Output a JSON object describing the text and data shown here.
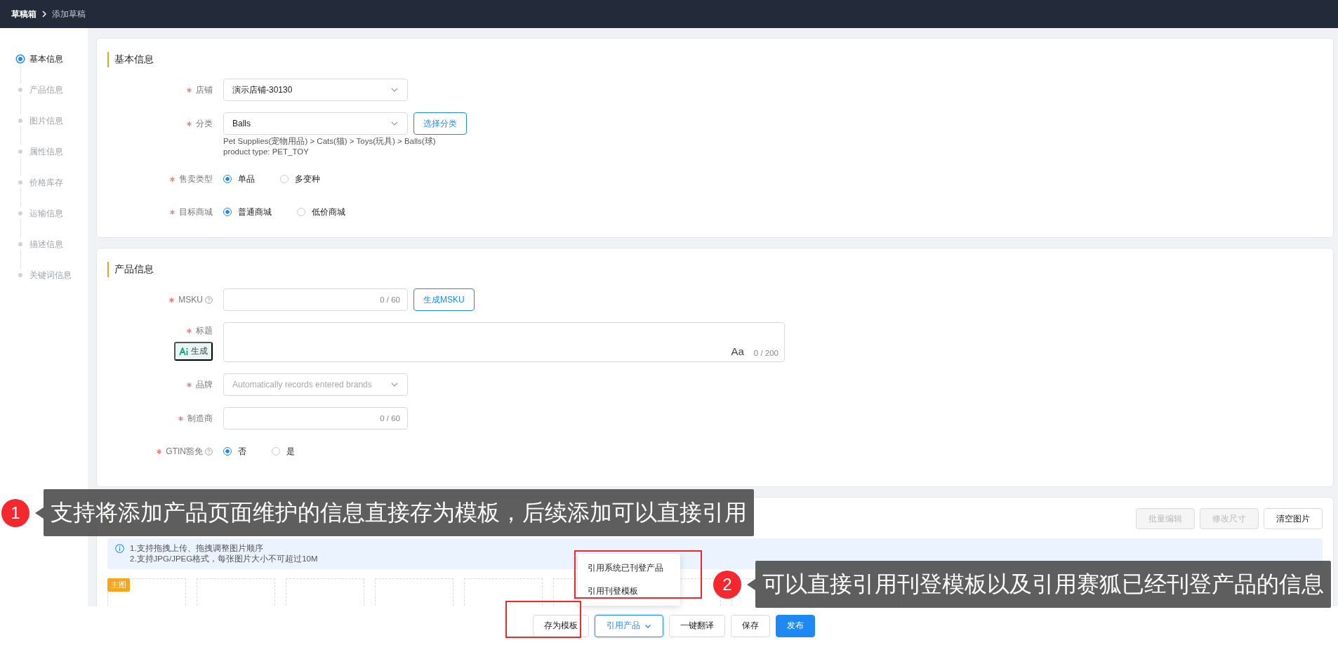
{
  "breadcrumb": [
    {
      "label": "草稿箱",
      "current": false
    },
    {
      "label": "添加草稿",
      "current": true
    }
  ],
  "steps": [
    {
      "label": "基本信息",
      "selected": true
    },
    {
      "label": "产品信息",
      "selected": false
    },
    {
      "label": "图片信息",
      "selected": false
    },
    {
      "label": "属性信息",
      "selected": false
    },
    {
      "label": "价格库存",
      "selected": false
    },
    {
      "label": "运输信息",
      "selected": false
    },
    {
      "label": "描述信息",
      "selected": false
    },
    {
      "label": "关键词信息",
      "selected": false
    }
  ],
  "sections": [
    {
      "title": "基本信息",
      "fields": [
        {
          "kind": "select",
          "label": "店铺",
          "required": true,
          "value": "演示店铺-30130"
        },
        {
          "kind": "select",
          "label": "分类",
          "required": true,
          "value": "Balls",
          "button": "选择分类",
          "notes": [
            "Pet Supplies(宠物用品) > Cats(猫) > Toys(玩具) > Balls(球)",
            "product type: PET_TOY"
          ]
        },
        {
          "kind": "radio",
          "label": "售卖类型",
          "required": true,
          "options": [
            {
              "label": "单品",
              "selected": true
            },
            {
              "label": "多变种",
              "selected": false
            }
          ]
        },
        {
          "kind": "radio",
          "label": "目标商城",
          "required": true,
          "options": [
            {
              "label": "普通商城",
              "selected": true
            },
            {
              "label": "低价商城",
              "selected": false
            }
          ]
        }
      ]
    },
    {
      "title": "产品信息",
      "fields": [
        {
          "kind": "input",
          "label": "MSKU",
          "required": true,
          "help": true,
          "counter": "0 / 60",
          "button": "生成MSKU"
        },
        {
          "kind": "textarea",
          "label": "标题",
          "required": true,
          "ai_label": "生成",
          "format_label": "Aa",
          "counter": "0 / 200"
        },
        {
          "kind": "select",
          "label": "品牌",
          "required": true,
          "placeholder": "Automatically records entered brands"
        },
        {
          "kind": "input",
          "label": "制造商",
          "required": true,
          "counter": "0 / 60"
        },
        {
          "kind": "radio",
          "label": "GTIN豁免",
          "required": true,
          "help": true,
          "options": [
            {
              "label": "否",
              "selected": true
            },
            {
              "label": "是",
              "selected": false
            }
          ]
        }
      ]
    }
  ],
  "images": {
    "buttons": [
      {
        "label": "批量编辑",
        "disabled": true
      },
      {
        "label": "修改尺寸",
        "disabled": true
      },
      {
        "label": "清空图片",
        "disabled": false
      }
    ],
    "tips": [
      "1.支持拖拽上传、拖拽调整图片顺序",
      "2.支持JPG/JPEG格式，每张图片大小不可超过10M"
    ],
    "main_badge": "主图",
    "slots": [
      {
        "main": true
      },
      {
        "main": false
      },
      {
        "main": false
      },
      {
        "main": false
      },
      {
        "main": false
      },
      {
        "main": false
      },
      {
        "main": false
      },
      {
        "main": false
      },
      {
        "main": false
      }
    ]
  },
  "actions": [
    {
      "label": "存为模板",
      "kind": "default"
    },
    {
      "label": "引用产品",
      "kind": "dropdown",
      "expanded": true,
      "menu": [
        "引用系统已刊登产品",
        "引用刊登模板"
      ]
    },
    {
      "label": "一键翻译",
      "kind": "default"
    },
    {
      "label": "保存",
      "kind": "default"
    },
    {
      "label": "发布",
      "kind": "primary"
    }
  ],
  "annotations": [
    {
      "number": "1",
      "text": "支持将添加产品页面维护的信息直接存为模板，后续添加可以直接引用"
    },
    {
      "number": "2",
      "text": "可以直接引用刊登模板以及引用赛狐已经刊登产品的信息"
    }
  ]
}
